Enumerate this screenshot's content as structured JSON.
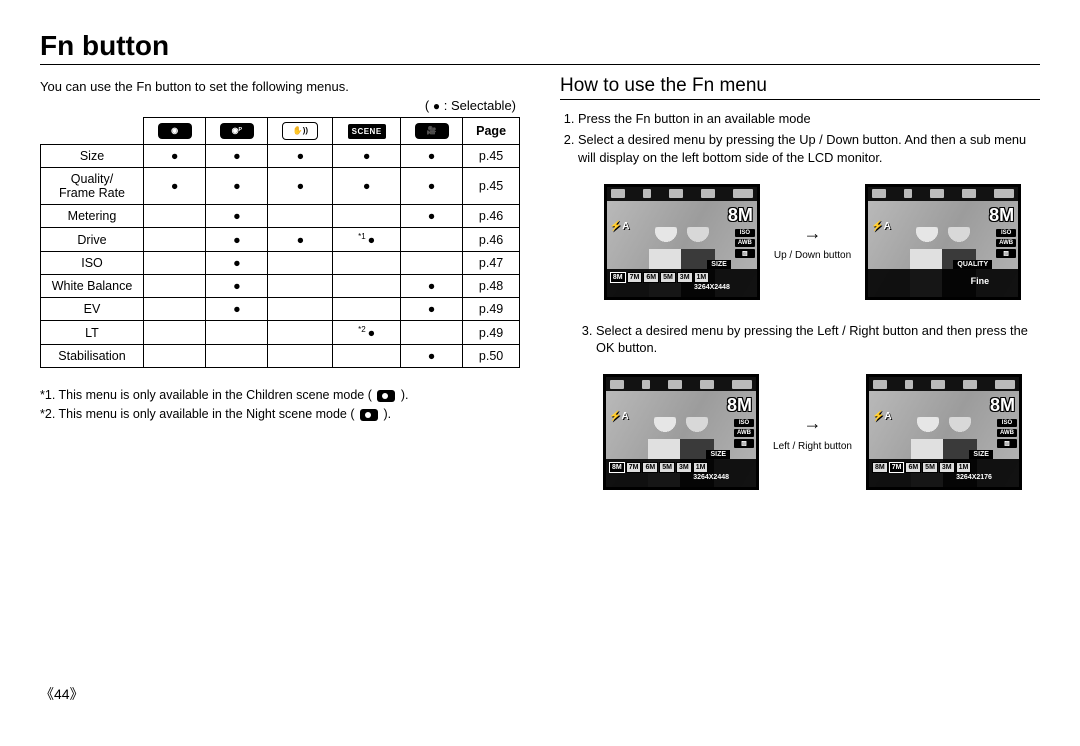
{
  "title": "Fn button",
  "left": {
    "intro": "You can use the Fn button to set the following menus.",
    "legend_prefix": "( ",
    "legend_bullet": "●",
    "legend_suffix": " : Selectable)",
    "table": {
      "page_header": "Page",
      "column_modes": [
        "auto",
        "program",
        "dis",
        "scene",
        "movie"
      ],
      "rows": [
        {
          "label": "Size",
          "cells": [
            "●",
            "●",
            "●",
            "●",
            "●"
          ],
          "page": "p.45"
        },
        {
          "label": "Quality/\nFrame Rate",
          "cells": [
            "●",
            "●",
            "●",
            "●",
            "●"
          ],
          "page": "p.45"
        },
        {
          "label": "Metering",
          "cells": [
            "",
            "●",
            "",
            "",
            "●"
          ],
          "page": "p.46"
        },
        {
          "label": "Drive",
          "cells": [
            "",
            "●",
            "●",
            "*1 ●",
            ""
          ],
          "page": "p.46"
        },
        {
          "label": "ISO",
          "cells": [
            "",
            "●",
            "",
            "",
            ""
          ],
          "page": "p.47"
        },
        {
          "label": "White Balance",
          "cells": [
            "",
            "●",
            "",
            "",
            "●"
          ],
          "page": "p.48"
        },
        {
          "label": "EV",
          "cells": [
            "",
            "●",
            "",
            "",
            "●"
          ],
          "page": "p.49"
        },
        {
          "label": "LT",
          "cells": [
            "",
            "",
            "",
            "*2 ●",
            ""
          ],
          "page": "p.49"
        },
        {
          "label": "Stabilisation",
          "cells": [
            "",
            "",
            "",
            "",
            "●"
          ],
          "page": "p.50"
        }
      ]
    },
    "footnote1_prefix": "*1. This menu is only available in the Children scene mode ( ",
    "footnote1_suffix": " ).",
    "footnote2_prefix": "*2. This menu is only available in the Night scene mode ( ",
    "footnote2_suffix": " )."
  },
  "right": {
    "heading": "How to use the Fn menu",
    "step1": "Press the Fn button in an available mode",
    "step2": "Select a desired menu by pressing the Up / Down button. And then a sub menu will display on the left bottom side of the LCD monitor.",
    "arrow1_label": "Up / Down button",
    "lcd1": {
      "corner": "8M",
      "flash_mode": "⚡A",
      "side_labels": [
        "ISO",
        "AWB",
        "▨"
      ],
      "bottom_label": "SIZE",
      "size_options": [
        "8M",
        "7M",
        "6M",
        "5M",
        "3M",
        "1M"
      ],
      "resolution": "3264X2448"
    },
    "lcd2": {
      "corner": "8M",
      "flash_mode": "⚡A",
      "side_labels": [
        "ISO",
        "AWB",
        "▨"
      ],
      "bottom_label": "QUALITY",
      "quality_value": "Fine"
    },
    "step3": "Select a desired menu by pressing the Left / Right button and then press the OK button.",
    "arrow2_label": "Left / Right button",
    "lcd3": {
      "corner": "8M",
      "flash_mode": "⚡A",
      "side_labels": [
        "ISO",
        "AWB",
        "▨"
      ],
      "bottom_label": "SIZE",
      "size_options": [
        "8M",
        "7M",
        "6M",
        "5M",
        "3M",
        "1M"
      ],
      "resolution": "3264X2448"
    },
    "lcd4": {
      "corner": "8M",
      "flash_mode": "⚡A",
      "side_labels": [
        "ISO",
        "AWB",
        "▨"
      ],
      "bottom_label": "SIZE",
      "size_options": [
        "8M",
        "7M",
        "6M",
        "5M",
        "3M",
        "1M"
      ],
      "resolution": "3264X2176"
    }
  },
  "page_number": "《44》"
}
